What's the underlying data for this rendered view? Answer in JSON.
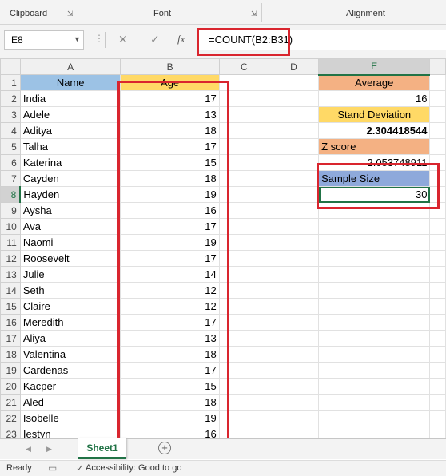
{
  "ribbon": {
    "clipboard_label": "Clipboard",
    "font_label": "Font",
    "alignment_label": "Alignment"
  },
  "formula_bar": {
    "name_box": "E8",
    "cancel_icon": "✕",
    "enter_icon": "✓",
    "fx_label": "fx",
    "formula": "=COUNT(B2:B31)"
  },
  "columns": [
    "A",
    "B",
    "C",
    "D",
    "E"
  ],
  "rows": [
    {
      "n": "1",
      "a": "Name",
      "b": "Age",
      "e": "Average"
    },
    {
      "n": "2",
      "a": "India",
      "b": "17",
      "e": "16"
    },
    {
      "n": "3",
      "a": "Adele",
      "b": "13",
      "e": "Stand Deviation"
    },
    {
      "n": "4",
      "a": "Aditya",
      "b": "18",
      "e": "2.304418544"
    },
    {
      "n": "5",
      "a": "Talha",
      "b": "17",
      "e": "Z score"
    },
    {
      "n": "6",
      "a": "Katerina",
      "b": "15",
      "e": "2.053748911"
    },
    {
      "n": "7",
      "a": "Cayden",
      "b": "18",
      "e": "Sample Size"
    },
    {
      "n": "8",
      "a": "Hayden",
      "b": "19",
      "e": "30"
    },
    {
      "n": "9",
      "a": "Aysha",
      "b": "16",
      "e": ""
    },
    {
      "n": "10",
      "a": "Ava",
      "b": "17",
      "e": ""
    },
    {
      "n": "11",
      "a": "Naomi",
      "b": "19",
      "e": ""
    },
    {
      "n": "12",
      "a": "Roosevelt",
      "b": "17",
      "e": ""
    },
    {
      "n": "13",
      "a": "Julie",
      "b": "14",
      "e": ""
    },
    {
      "n": "14",
      "a": "Seth",
      "b": "12",
      "e": ""
    },
    {
      "n": "15",
      "a": "Claire",
      "b": "12",
      "e": ""
    },
    {
      "n": "16",
      "a": "Meredith",
      "b": "17",
      "e": ""
    },
    {
      "n": "17",
      "a": "Aliya",
      "b": "13",
      "e": ""
    },
    {
      "n": "18",
      "a": "Valentina",
      "b": "18",
      "e": ""
    },
    {
      "n": "19",
      "a": "Cardenas",
      "b": "17",
      "e": ""
    },
    {
      "n": "20",
      "a": "Kacper",
      "b": "15",
      "e": ""
    },
    {
      "n": "21",
      "a": "Aled",
      "b": "18",
      "e": ""
    },
    {
      "n": "22",
      "a": "Isobelle",
      "b": "19",
      "e": ""
    },
    {
      "n": "23",
      "a": "Iestyn",
      "b": "16",
      "e": ""
    }
  ],
  "sheet_tab": "Sheet1",
  "status": {
    "ready": "Ready",
    "accessibility": "Accessibility: Good to go"
  },
  "colors": {
    "accent": "#217346",
    "annotation_red": "#d9252e",
    "name_header": "#9cc2e5",
    "age_header": "#ffd966",
    "salmon": "#f4b183",
    "sample_blue": "#8ea9db"
  }
}
